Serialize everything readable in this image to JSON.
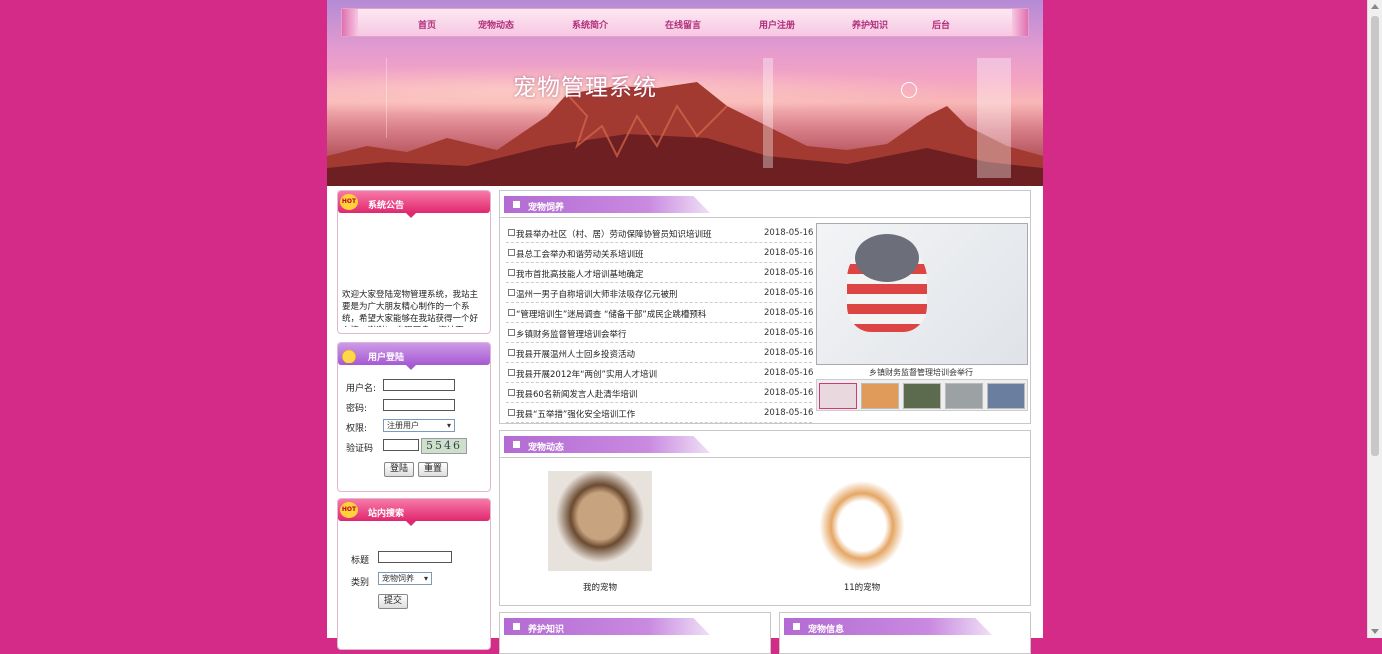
{
  "nav": [
    "首页",
    "宠物动态",
    "系统简介",
    "在线留言",
    "用户注册",
    "养护知识",
    "后台"
  ],
  "site_title": "宠物管理系统",
  "notice": {
    "title": "系统公告",
    "badge": "HOT",
    "text": "欢迎大家登陆宠物管理系统，我站主要是为广大朋友精心制作的一个系统，希望大家能够在我站获得一个好心情，谢谢！ 自强不息，海纳百"
  },
  "login": {
    "title": "用户登陆",
    "username_label": "用户名:",
    "password_label": "密码:",
    "role_label": "权限:",
    "role_value": "注册用户",
    "captcha_label": "验证码",
    "captcha": "5546",
    "login_button": "登陆",
    "reset_button": "重置"
  },
  "search": {
    "title": "站内搜索",
    "badge": "HOT",
    "title_label": "标题",
    "category_label": "类别",
    "category_value": "宠物饲养",
    "submit": "提交"
  },
  "feeding": {
    "title": "宠物饲养",
    "news": [
      {
        "title": "我县举办社区（村、居）劳动保障协管员知识培训班",
        "date": "2018-05-16"
      },
      {
        "title": "县总工会举办和谐劳动关系培训班",
        "date": "2018-05-16"
      },
      {
        "title": "我市首批高技能人才培训基地确定",
        "date": "2018-05-16"
      },
      {
        "title": "温州一男子自称培训大师非法吸存亿元被刑",
        "date": "2018-05-16"
      },
      {
        "title": "“管理培训生”迷局调查 “储备干部”成民企跳槽预科",
        "date": "2018-05-16"
      },
      {
        "title": "乡镇财务监督管理培训会举行",
        "date": "2018-05-16"
      },
      {
        "title": "我县开展温州人士回乡投资活动",
        "date": "2018-05-16"
      },
      {
        "title": "我县开展2012年“两创”实用人才培训",
        "date": "2018-05-16"
      },
      {
        "title": "我县60名新闻发言人赴清华培训",
        "date": "2018-05-16"
      },
      {
        "title": "我县“五举措”强化安全培训工作",
        "date": "2018-05-16"
      }
    ],
    "slide_caption": "乡镇财务监督管理培训会举行"
  },
  "dynamics": {
    "title": "宠物动态",
    "items": [
      {
        "label": "我的宠物"
      },
      {
        "label": "11的宠物"
      }
    ]
  },
  "care": {
    "title": "养护知识"
  },
  "info": {
    "title": "宠物信息"
  }
}
